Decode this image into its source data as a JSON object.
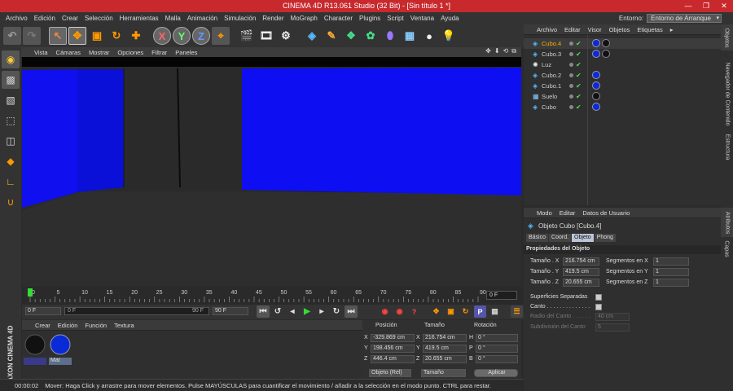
{
  "window": {
    "title": "CINEMA 4D R13.061 Studio (32 Bit) - [Sin título 1 *]",
    "controls": [
      "—",
      "❐",
      "✕"
    ]
  },
  "menu": [
    "Archivo",
    "Edición",
    "Crear",
    "Selección",
    "Herramientas",
    "Malla",
    "Animación",
    "Simulación",
    "Render",
    "MoGraph",
    "Character",
    "Plugins",
    "Script",
    "Ventana",
    "Ayuda"
  ],
  "entorno": {
    "label": "Entorno:",
    "value": "Entorno de Arranque"
  },
  "toolbar_icons": [
    "undo-icon",
    "redo-icon",
    "live-select-icon",
    "move-icon",
    "scale-icon",
    "rotate-icon",
    "add-icon",
    "x-axis-icon",
    "y-axis-icon",
    "z-axis-icon",
    "world-coord-icon",
    "render-view-icon",
    "render-picture-icon",
    "render-settings-icon",
    "cube-icon",
    "spline-pen-icon",
    "nurbs-icon",
    "array-icon",
    "deformer-icon",
    "floor-icon",
    "camera-icon",
    "light-icon"
  ],
  "axis_labels": [
    "X",
    "Y",
    "Z"
  ],
  "viewport_menu": [
    "Vista",
    "Cámaras",
    "Mostrar",
    "Opciones",
    "Filtrar",
    "Paneles"
  ],
  "viewport_icons": [
    "✥",
    "⬇",
    "⟲",
    "⧉"
  ],
  "timeline": {
    "ticks": [
      "0",
      "5",
      "10",
      "15",
      "20",
      "25",
      "30",
      "35",
      "40",
      "45",
      "50",
      "55",
      "60",
      "65",
      "70",
      "75",
      "80",
      "85",
      "90"
    ],
    "current_frame": "0 F"
  },
  "playback": {
    "start": "0 F",
    "range_start": "0 F",
    "range_end": "90 F",
    "end": "90 F",
    "controls": [
      "⏮",
      "↺",
      "◂",
      "▶",
      "▸",
      "↻",
      "⏭"
    ]
  },
  "material_manager": {
    "menu": [
      "Crear",
      "Edición",
      "Función",
      "Textura"
    ],
    "materials": [
      {
        "name": "",
        "color": "#111111"
      },
      {
        "name": "Mat",
        "color": "#0a2ad8"
      }
    ]
  },
  "coord_manager": {
    "headers": [
      "Posición",
      "Tamaño",
      "Rotación"
    ],
    "rows": [
      {
        "axis": "X",
        "pos": "-329.869 cm",
        "saxis": "X",
        "size": "216.754 cm",
        "raxis": "H",
        "rot": "0 °"
      },
      {
        "axis": "Y",
        "pos": "198.456 cm",
        "saxis": "Y",
        "size": "419.5 cm",
        "raxis": "P",
        "rot": "0 °"
      },
      {
        "axis": "Z",
        "pos": "446.4 cm",
        "saxis": "Z",
        "size": "20.655 cm",
        "raxis": "B",
        "rot": "0 °"
      }
    ],
    "mode": "Objeto (Rel)",
    "size_mode": "Tamaño",
    "apply": "Aplicar"
  },
  "status": {
    "time": "00:00:02",
    "message": "Mover: Haga Click y arrastre para mover elementos. Pulse MAYÚSCULAS para cuantificar el movimiento / añadir a la selección en el modo punto. CTRL para restar."
  },
  "object_manager": {
    "menu": [
      "Archivo",
      "Editar",
      "Visor",
      "Objetos",
      "Etiquetas",
      "▸"
    ],
    "objects": [
      {
        "name": "Cubo.4",
        "selected": true,
        "tags": [
          "blue",
          "black"
        ]
      },
      {
        "name": "Cubo.3",
        "selected": false,
        "tags": [
          "blue",
          "black"
        ]
      },
      {
        "name": "Luz",
        "selected": false,
        "tags": []
      },
      {
        "name": "Cubo.2",
        "selected": false,
        "tags": [
          "blue"
        ]
      },
      {
        "name": "Cubo.1",
        "selected": false,
        "tags": [
          "blue"
        ]
      },
      {
        "name": "Suelo",
        "selected": false,
        "tags": [
          "black"
        ]
      },
      {
        "name": "Cubo",
        "selected": false,
        "tags": [
          "blue"
        ]
      }
    ]
  },
  "right_tabs": [
    "Objetos",
    "Navegador de Contenido",
    "Estructura",
    "Atributos",
    "Capas"
  ],
  "attributes": {
    "menu": [
      "Modo",
      "Editar",
      "Datos de Usuario"
    ],
    "title": "Objeto Cubo [Cubo.4]",
    "tabs": [
      "Básico",
      "Coord.",
      "Objeto",
      "Phong"
    ],
    "section": "Propiedades del Objeto",
    "size_x_label": "Tamaño . X",
    "size_x": "216.754 cm",
    "size_y_label": "Tamaño . Y",
    "size_y": "419.5 cm",
    "size_z_label": "Tamaño . Z",
    "size_z": "20.655 cm",
    "seg_x_label": "Segmentos en X",
    "seg_x": "1",
    "seg_y_label": "Segmentos en Y",
    "seg_y": "1",
    "seg_z_label": "Segmentos en Z",
    "seg_z": "1",
    "separate_label": "Superficies Separadas",
    "fillet_label": "Canto . . . . . . . . . . . . . .",
    "fillet_radius_label": "Radio del Canto . . . . . .",
    "fillet_radius": "40 cm",
    "fillet_sub_label": "Subdivisión del Canto",
    "fillet_sub": "5"
  },
  "maxon_logo": "MAXON CINEMA 4D"
}
